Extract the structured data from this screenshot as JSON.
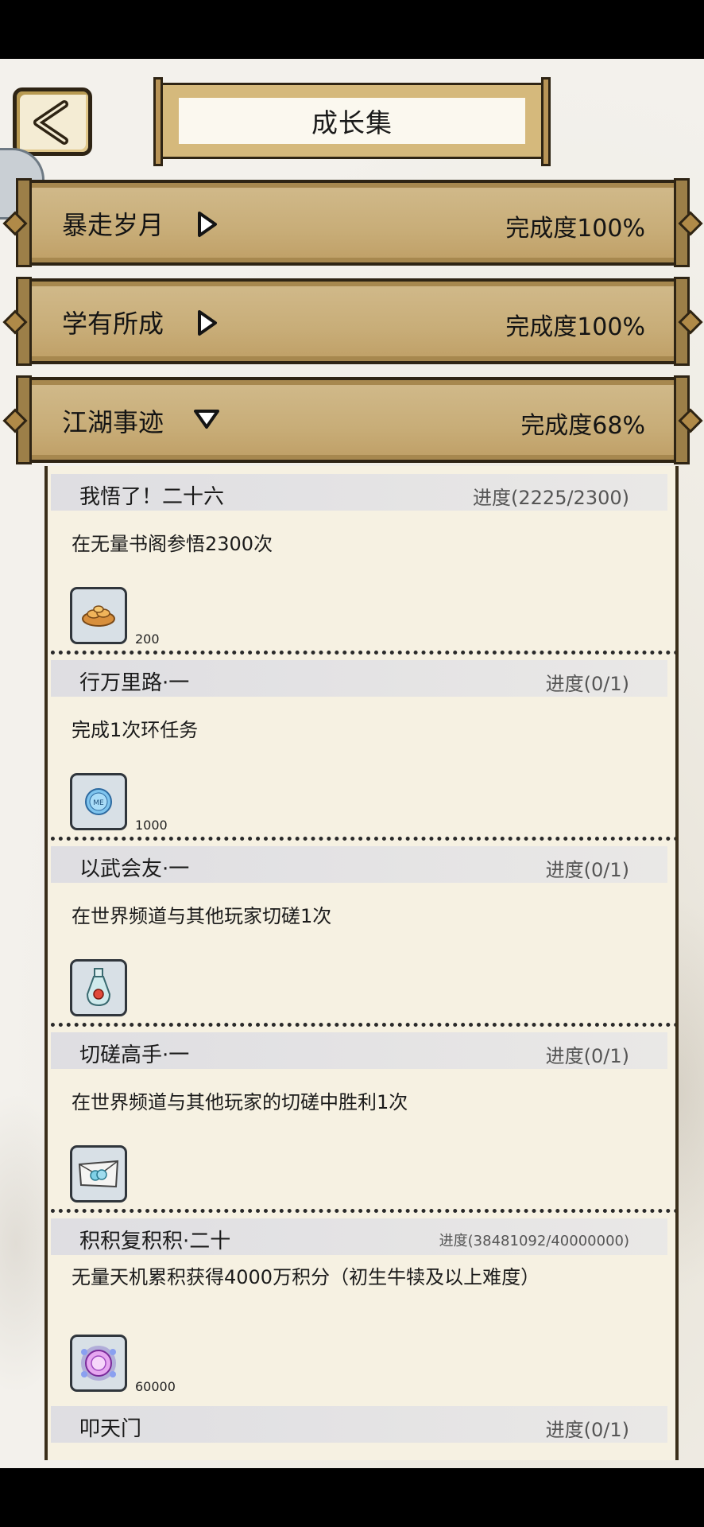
{
  "header": {
    "title": "成长集"
  },
  "categories": [
    {
      "name": "暴走岁月",
      "completion": "完成度100%",
      "expanded": false
    },
    {
      "name": "学有所成",
      "completion": "完成度100%",
      "expanded": false
    },
    {
      "name": "江湖事迹",
      "completion": "完成度68%",
      "expanded": true
    }
  ],
  "tasks": [
    {
      "name": "我悟了！二十六",
      "progress": "进度(2225/2300)",
      "desc": "在无量书阁参悟2300次",
      "reward_icon": "gold-ingots-icon",
      "reward_qty": "200"
    },
    {
      "name": "行万里路·一",
      "progress": "进度(0/1)",
      "desc": "完成1次环任务",
      "reward_icon": "me-coin-icon",
      "reward_qty": "1000"
    },
    {
      "name": "以武会友·一",
      "progress": "进度(0/1)",
      "desc": "在世界频道与其他玩家切磋1次",
      "reward_icon": "potion-bottle-icon",
      "reward_qty": ""
    },
    {
      "name": "切磋高手·一",
      "progress": "进度(0/1)",
      "desc": "在世界频道与其他玩家的切磋中胜利1次",
      "reward_icon": "pill-packet-icon",
      "reward_qty": ""
    },
    {
      "name": "积积复积积·二十",
      "progress": "进度(38481092/40000000)",
      "desc": "无量天机累积获得4000万积分（初生牛犊及以上难度）",
      "reward_icon": "purple-orb-icon",
      "reward_qty": "60000"
    },
    {
      "name": "叩天门",
      "progress": "进度(0/1)",
      "desc": "",
      "reward_icon": "",
      "reward_qty": ""
    }
  ],
  "colors": {
    "scroll_gold": "#c8ad78",
    "ink_dark": "#2e2414",
    "panel_bg": "#f6f1e2"
  }
}
